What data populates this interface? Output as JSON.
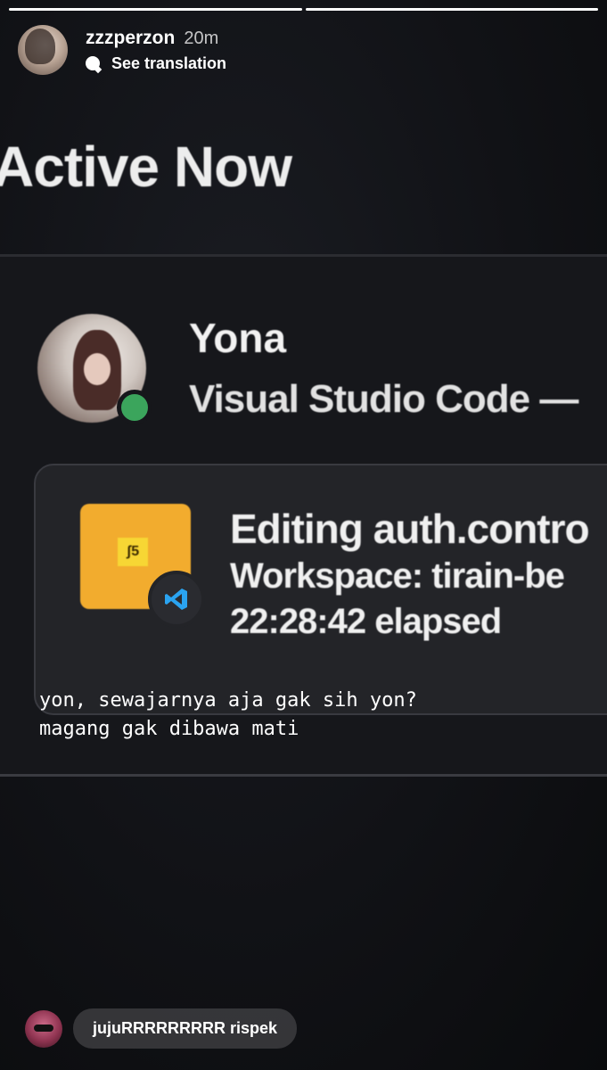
{
  "story": {
    "progress": [
      1.0,
      1.0
    ]
  },
  "header": {
    "username": "zzzperzon",
    "time_ago": "20m",
    "translate_label": "See translation"
  },
  "screen": {
    "section_title": "Active Now",
    "friend": {
      "name": "Yona",
      "app": "Visual Studio Code —",
      "status_color": "#3ba55c"
    },
    "activity": {
      "editing": "Editing auth.contro",
      "workspace": "Workspace: tirain-be",
      "elapsed": "22:28:42 elapsed",
      "file_badge": "JS"
    }
  },
  "caption": {
    "line1": "yon, sewajarnya aja gak sih yon?",
    "line2": "magang gak dibawa mati"
  },
  "reply": {
    "text": "jujuRRRRRRRRR rispek"
  },
  "icons": {
    "translate": "speech-bubble-icon",
    "app": "vscode-icon",
    "file": "js-file-icon"
  }
}
